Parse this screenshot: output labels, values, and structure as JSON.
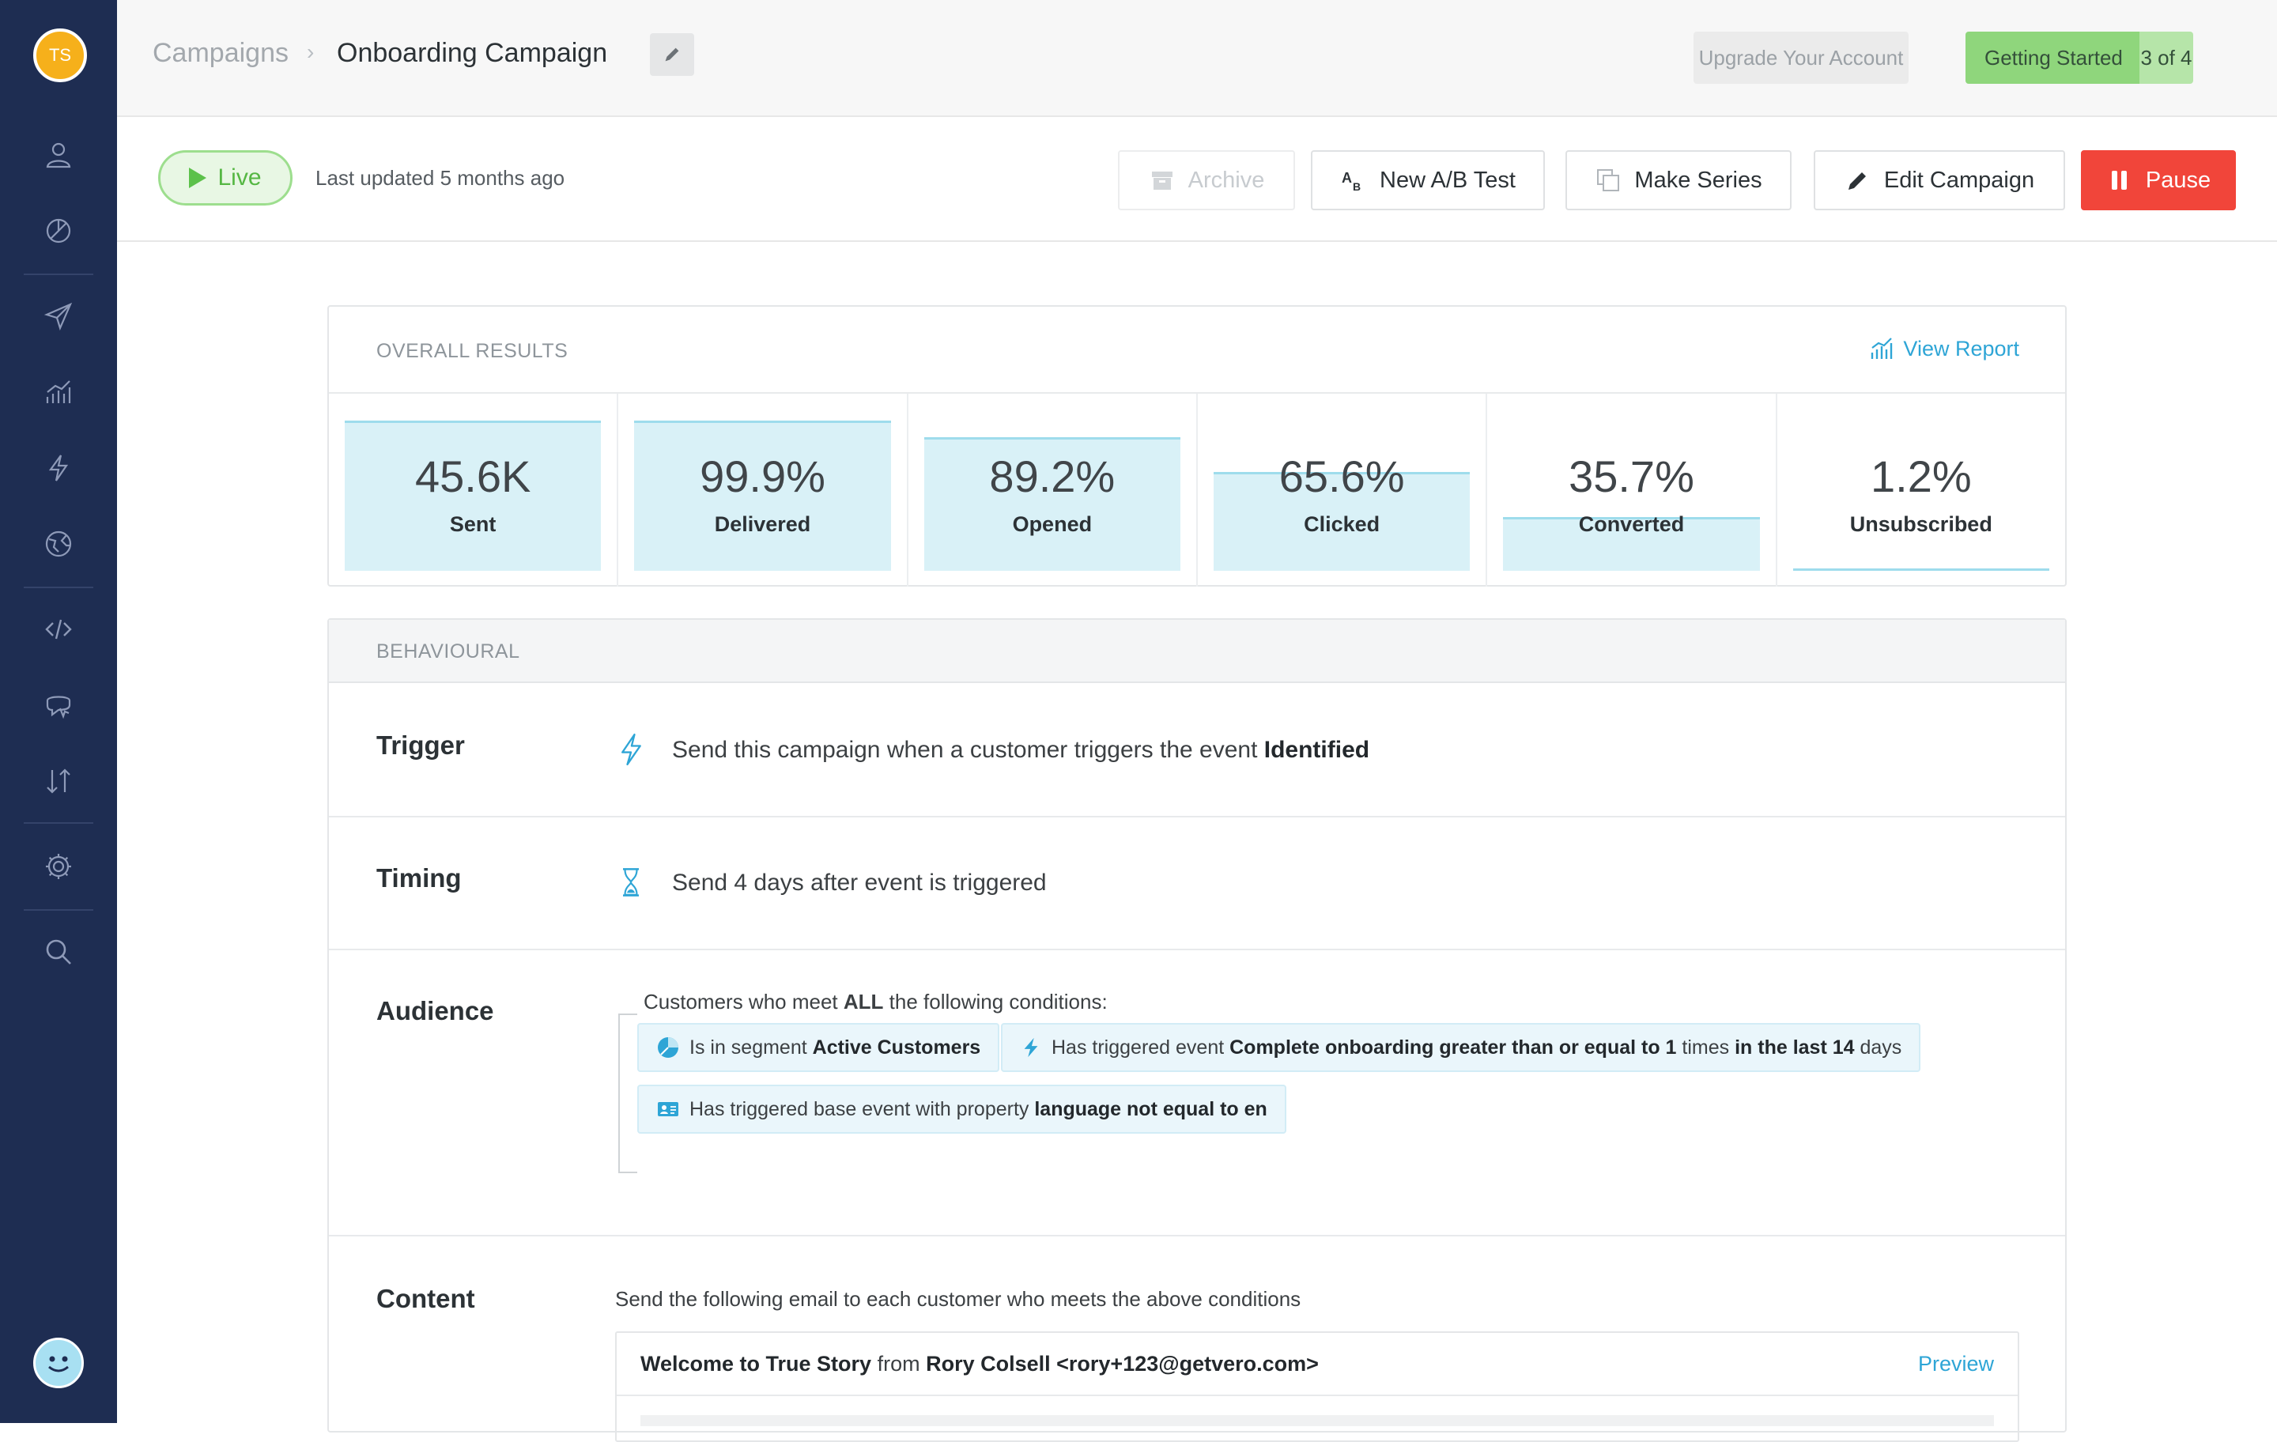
{
  "sidebar": {
    "avatar_initials": "TS",
    "avatar_color": "#f6b01b",
    "background": "#1e2d52",
    "icons": [
      "person-icon",
      "segments-pie-icon",
      "send-plane-icon",
      "analytics-icon",
      "lightning-icon",
      "globe-icon",
      "code-icon",
      "chat-bubble-icon",
      "import-export-icon",
      "gear-icon",
      "search-icon"
    ],
    "bottom_avatar": "smiley-avatar"
  },
  "header": {
    "breadcrumb_root": "Campaigns",
    "breadcrumb_separator": "›",
    "breadcrumb_current": "Onboarding Campaign",
    "upgrade_label": "Upgrade Your Account",
    "getting_started_label": "Getting Started",
    "getting_started_progress": "3 of 4",
    "getting_started_progress_value": 0.75
  },
  "actions": {
    "status": "Live",
    "last_updated": "Last updated 5 months ago",
    "archive_label": "Archive",
    "ab_test_label": "New A/B Test",
    "make_series_label": "Make Series",
    "edit_label": "Edit Campaign",
    "pause_label": "Pause",
    "pause_color": "#f1453a",
    "live_color": "#5cc14a"
  },
  "results": {
    "title": "OVERALL RESULTS",
    "view_report_label": "View Report",
    "metrics": [
      {
        "value": "45.6K",
        "label": "Sent",
        "fill": 1.0
      },
      {
        "value": "99.9%",
        "label": "Delivered",
        "fill": 0.999
      },
      {
        "value": "89.2%",
        "label": "Opened",
        "fill": 0.892
      },
      {
        "value": "65.6%",
        "label": "Clicked",
        "fill": 0.656
      },
      {
        "value": "35.7%",
        "label": "Converted",
        "fill": 0.357
      },
      {
        "value": "1.2%",
        "label": "Unsubscribed",
        "fill": 0.012
      }
    ]
  },
  "behavioural": {
    "title": "BEHAVIOURAL",
    "trigger_label": "Trigger",
    "trigger_text": "Send this campaign when a customer triggers the event ",
    "trigger_event": "Identified",
    "timing_label": "Timing",
    "timing_text": "Send 4 days after event is triggered",
    "audience_label": "Audience",
    "audience_intro_pre": "Customers who meet ",
    "audience_intro_bold": "ALL",
    "audience_intro_post": " the following conditions:",
    "conditions": [
      {
        "icon": "segment-pie-icon",
        "parts": [
          "Is in segment ",
          "Active Customers"
        ]
      },
      {
        "icon": "lightning-icon",
        "parts": [
          "Has triggered event ",
          "Complete onboarding greater than or equal to 1",
          " times ",
          "in the last 14",
          " days"
        ]
      },
      {
        "icon": "property-card-icon",
        "parts": [
          "Has triggered base event with property ",
          "language not equal to en"
        ]
      }
    ],
    "content_label": "Content",
    "content_intro": "Send the following email to each customer who meets the above conditions",
    "email_subject": "Welcome to True Story",
    "email_from_word": " from ",
    "email_sender": "Rory Colsell <rory+123@getvero.com>",
    "preview_label": "Preview"
  }
}
